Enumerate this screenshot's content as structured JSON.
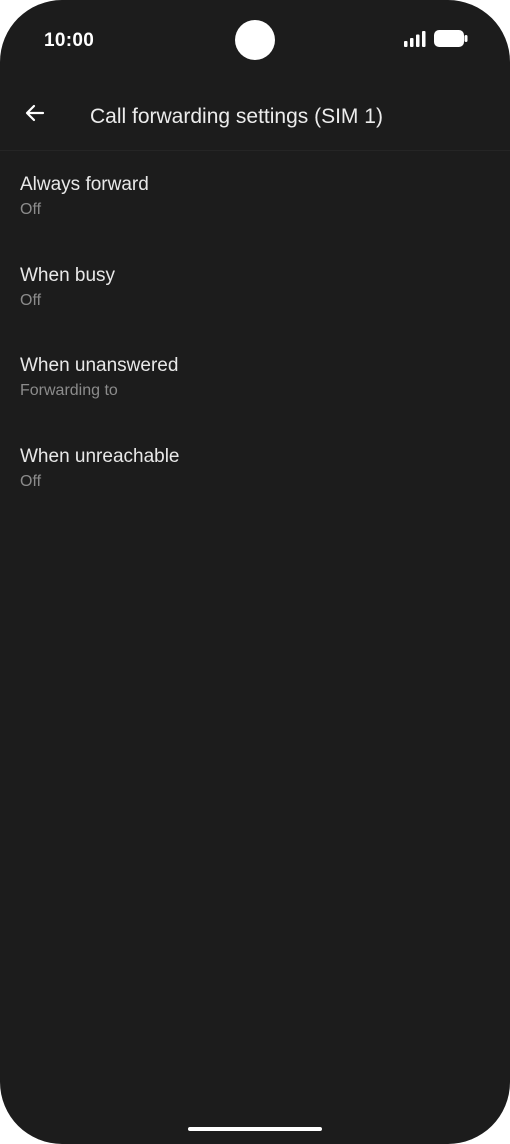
{
  "status_bar": {
    "time": "10:00",
    "icons": [
      "signal-icon",
      "battery-icon"
    ]
  },
  "app_bar": {
    "back_icon": "arrow-back-icon",
    "title": "Call forwarding settings (SIM 1)"
  },
  "settings": {
    "items": [
      {
        "title": "Always forward",
        "summary": "Off"
      },
      {
        "title": "When busy",
        "summary": "Off"
      },
      {
        "title": "When unanswered",
        "summary": "Forwarding to"
      },
      {
        "title": "When unreachable",
        "summary": "Off"
      }
    ]
  },
  "colors": {
    "background": "#1c1c1c",
    "title_text": "#e8e8e8",
    "summary_text": "#8c8c8c"
  }
}
